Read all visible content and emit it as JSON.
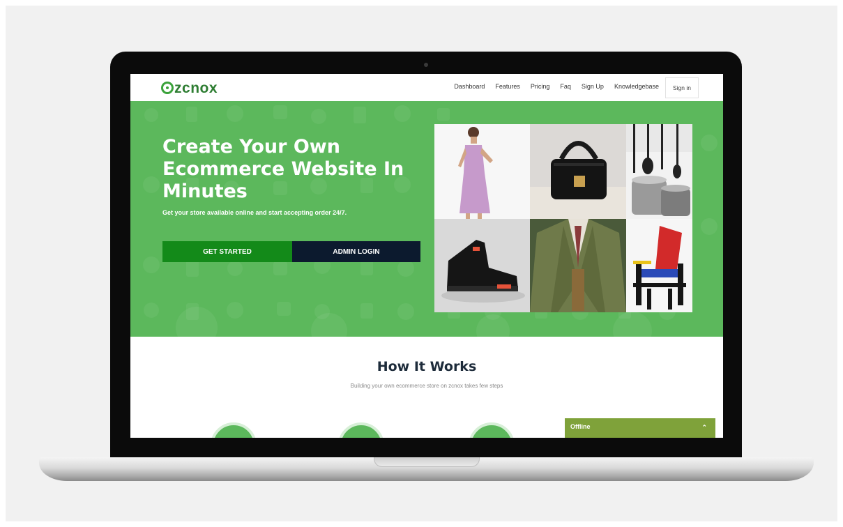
{
  "brand": {
    "logo_text_a": "zc",
    "logo_text_b": "nox",
    "accent": "#5cb85c",
    "dark": "#0c1a2e"
  },
  "nav": {
    "links": [
      "Dashboard",
      "Features",
      "Pricing",
      "Faq",
      "Sign Up",
      "Knowledgebase"
    ],
    "signin_label": "Sign in"
  },
  "hero": {
    "title_lines": [
      "Create Your Own",
      "Ecommerce Website In",
      "Minutes"
    ],
    "subtitle": "Get your store available online and start accepting order 24/7.",
    "primary_button": "GET STARTED",
    "secondary_button": "ADMIN LOGIN",
    "product_images": [
      "dress-photo",
      "handbag-photo",
      "cookware-photo",
      "sneaker-photo",
      "blazer-photo",
      "chair-photo"
    ]
  },
  "how": {
    "title": "How It Works",
    "subtitle": "Building your own ecommerce store on zcnox takes few steps"
  },
  "chat_widget": {
    "status": "Offline",
    "icon": "chevron-up-icon"
  }
}
